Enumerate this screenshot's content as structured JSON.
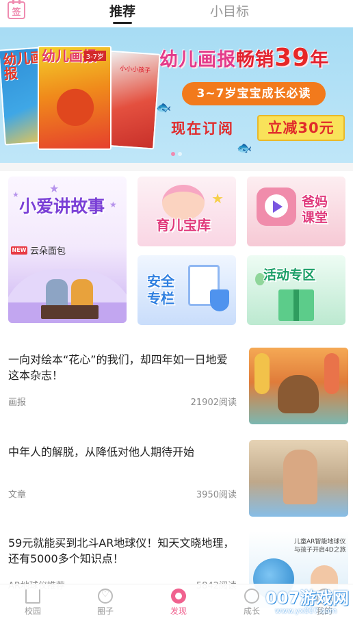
{
  "topbar": {
    "sign_icon_text": "签",
    "tabs": [
      {
        "label": "推荐",
        "active": true
      },
      {
        "label": "小目标",
        "active": false
      }
    ]
  },
  "banner": {
    "magazines": [
      {
        "title": "幼儿画报"
      },
      {
        "title": "幼儿画报",
        "issue": "3-7岁"
      },
      {
        "title": "",
        "sub": "小小小孩子"
      }
    ],
    "headline_prefix": "幼儿画报",
    "headline_mid": "畅销",
    "headline_number": "39",
    "headline_suffix": "年",
    "age_pill": "3~7岁宝宝成长必读",
    "subscribe_text": "现在订阅",
    "discount_text": "立减30元",
    "carousel_count": 2,
    "carousel_active": 0
  },
  "categories": {
    "story": {
      "title": "小爱讲故事",
      "badge": "NEW",
      "item_name": "云朵面包"
    },
    "parenting": {
      "title": "育儿宝库"
    },
    "parent_class": {
      "title_line1": "爸妈",
      "title_line2": "课堂"
    },
    "safety": {
      "title_line1": "安全",
      "title_line2": "专栏"
    },
    "events": {
      "title": "活动专区"
    }
  },
  "articles": [
    {
      "title": "一向对绘本“花心”的我们，却四年如一日地爱这本杂志！",
      "tag": "画报",
      "reads": "21902阅读"
    },
    {
      "title": "中年人的解脱，从降低对他人期待开始",
      "tag": "文章",
      "reads": "3950阅读"
    },
    {
      "title": "59元就能买到北斗AR地球仪！知天文晓地理，还有5000多个知识点！",
      "tag": "AR地球仪推荐",
      "reads": "5842阅读",
      "thumb_text_line1": "儿童AR智能地球仪",
      "thumb_text_line2": "与孩子开启4D之旅"
    }
  ],
  "bottom_nav": [
    {
      "label": "校园",
      "icon": "house-icon",
      "active": false
    },
    {
      "label": "圈子",
      "icon": "heart-icon",
      "active": false
    },
    {
      "label": "发现",
      "icon": "discover-icon",
      "active": true
    },
    {
      "label": "成长",
      "icon": "grow-icon",
      "active": false
    },
    {
      "label": "我的",
      "icon": "me-icon",
      "active": false
    }
  ],
  "watermark": {
    "big": "007游戏网",
    "small": "www.yx007.com"
  },
  "colors": {
    "accent_pink": "#f0628f",
    "banner_sky": "#a7dcf4",
    "headline_red": "#e2222f",
    "pill_orange": "#f27a1c"
  }
}
